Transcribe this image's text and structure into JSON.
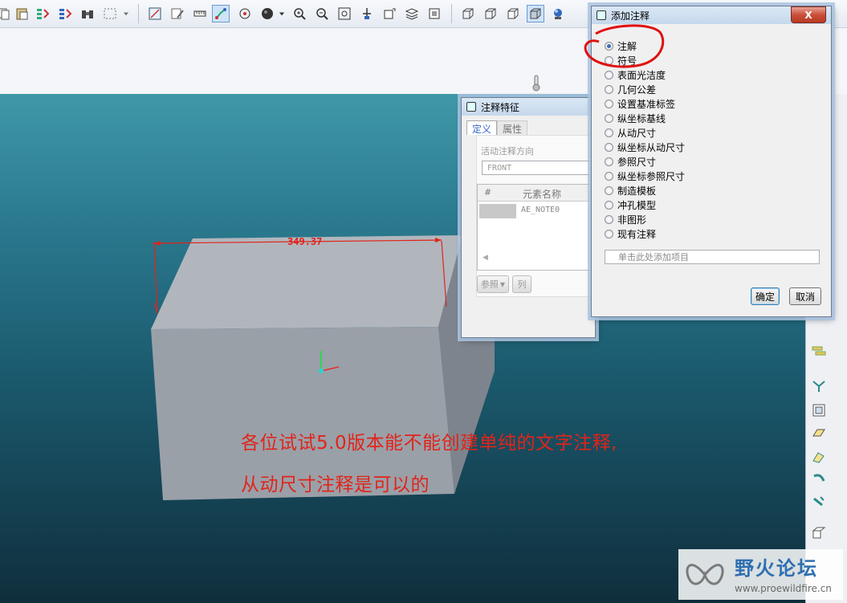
{
  "toolbar": {
    "icons": [
      "copy-icon",
      "paste-icon",
      "regenerate-icon",
      "regenerate-manager-icon",
      "binoculars-icon",
      "select-box-icon",
      "dropdown-icon",
      "datum-display-icon",
      "edit-icon",
      "measure-icon",
      "datum-axis-icon",
      "spin-center-icon",
      "shading-icon",
      "zoom-in-icon",
      "zoom-out-icon",
      "refit-icon",
      "orient-icon",
      "saved-views-icon",
      "layers-icon",
      "view-manager-icon",
      "wireframe-icon",
      "hidden-line-icon",
      "no-hidden-icon",
      "shaded-icon",
      "appearance-icon"
    ]
  },
  "viewport": {
    "dimension_value": "349.37",
    "annotation_line1": "各位试试5.0版本能不能创建单纯的文字注释,",
    "annotation_line2": "从动尺寸注释是可以的"
  },
  "note_feature_dialog": {
    "title": "注释特征",
    "tab_definition": "定义",
    "tab_properties": "属性",
    "orientation_label": "活动注释方向",
    "orientation_value": "FRONT",
    "col_hash": "#",
    "col_element_name": "元素名称",
    "row_value": "AE_NOTE0",
    "reference_button": "参照",
    "column_button": "列"
  },
  "add_note_dialog": {
    "title": "添加注释",
    "close_label": "X",
    "options": [
      "注解",
      "符号",
      "表面光洁度",
      "几何公差",
      "设置基准标签",
      "纵坐标基线",
      "从动尺寸",
      "纵坐标从动尺寸",
      "参照尺寸",
      "纵坐标参照尺寸",
      "制造模板",
      "冲孔模型",
      "非图形",
      "现有注释"
    ],
    "selected_option": "注解",
    "add_item_placeholder": "单击此处添加项目",
    "ok_label": "确定",
    "cancel_label": "取消"
  },
  "watermark": {
    "site_name": "野火论坛",
    "url": "www.proewildfire.cn"
  },
  "colors": {
    "annotation_red": "#e2231a",
    "highlight_circle": "#e01010",
    "part_face_front": "#9aa0a8",
    "part_face_top": "#b2b7be",
    "part_face_side": "#7f868f"
  }
}
